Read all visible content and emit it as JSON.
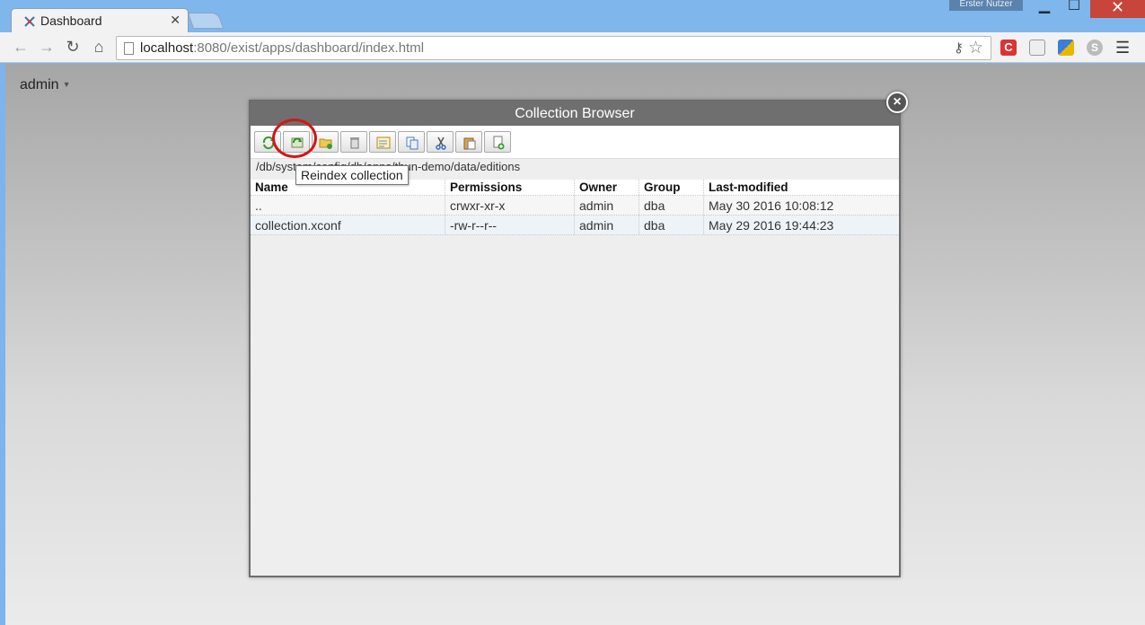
{
  "browser": {
    "tab_title": "Dashboard",
    "user_badge": "Erster Nutzer",
    "url_host": "localhost",
    "url_rest": ":8080/exist/apps/dashboard/index.html"
  },
  "page": {
    "user_menu": "admin"
  },
  "dialog": {
    "title": "Collection Browser",
    "path": "/db/system/config/db/apps/thun-demo/data/editions",
    "tooltip": "Reindex collection",
    "columns": [
      "Name",
      "Permissions",
      "Owner",
      "Group",
      "Last-modified"
    ],
    "rows": [
      [
        "..",
        "crwxr-xr-x",
        "admin",
        "dba",
        "May 30 2016 10:08:12"
      ],
      [
        "collection.xconf",
        "-rw-r--r--",
        "admin",
        "dba",
        "May 29 2016 19:44:23"
      ]
    ],
    "toolbar": [
      {
        "icon": "refresh-icon",
        "label": "Refresh"
      },
      {
        "icon": "reindex-icon",
        "label": "Reindex collection"
      },
      {
        "icon": "new-collection-icon",
        "label": "New collection"
      },
      {
        "icon": "delete-icon",
        "label": "Delete"
      },
      {
        "icon": "properties-icon",
        "label": "Properties"
      },
      {
        "icon": "copy-icon",
        "label": "Copy"
      },
      {
        "icon": "cut-icon",
        "label": "Cut"
      },
      {
        "icon": "paste-icon",
        "label": "Paste"
      },
      {
        "icon": "upload-icon",
        "label": "Upload"
      }
    ]
  }
}
